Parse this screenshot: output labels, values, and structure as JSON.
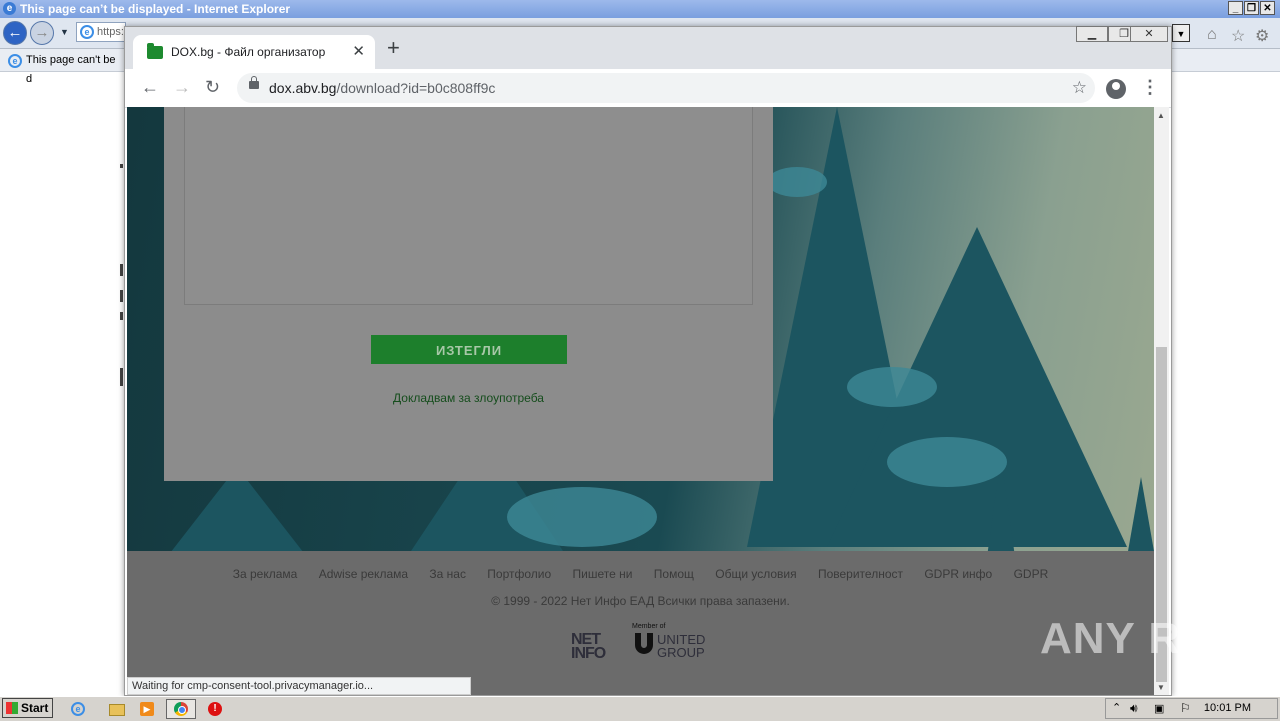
{
  "ie": {
    "title": "This page can’t be displayed - Internet Explorer",
    "address_fragment": "https:",
    "tab_label": "This page can't be d"
  },
  "chrome": {
    "tab_title": "DOX.bg - Файл организатор",
    "url_host": "dox.abv.bg",
    "url_path": "/download?id=b0c808ff9c"
  },
  "page": {
    "download_button": "ИЗТЕГЛИ",
    "report_link": "Докладвам за злоупотреба",
    "footer_links": [
      "За реклама",
      "Adwise реклама",
      "За нас",
      "Портфолио",
      "Пишете ни",
      "Помощ",
      "Общи условия",
      "Поверителност",
      "GDPR инфо",
      "GDPR"
    ],
    "copyright": "© 1999 - 2022 Нет Инфо ЕАД Всички права запазени.",
    "netinfo_logo_line1": "NET",
    "netinfo_logo_line2": "INFO",
    "member_of": "Member of",
    "united_group_line1": "UNITED",
    "united_group_line2": "GROUP"
  },
  "status_bar": "Waiting for cmp-consent-tool.privacymanager.io...",
  "watermark": "ANY RUN",
  "taskbar": {
    "start_label": "Start",
    "clock": "10:01 PM"
  },
  "colors": {
    "download_button": "#1d7f2c",
    "overlay_gray": "#6b6b6b"
  }
}
